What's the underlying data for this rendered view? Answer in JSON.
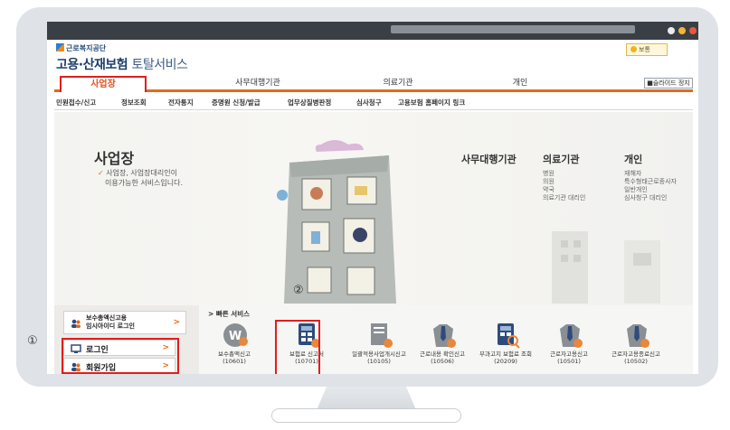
{
  "header": {
    "org_name": "근로복지공단",
    "service_title_main": "고용·산재보험",
    "service_title_rest": "토탈서비스",
    "weather_label": "보통"
  },
  "top_tabs": [
    {
      "label": "사업장"
    },
    {
      "label": "사무대행기관"
    },
    {
      "label": "의료기관"
    },
    {
      "label": "개인"
    }
  ],
  "slide_stop_label": "■슬라이드 정지",
  "submenu": [
    "민원접수/신고",
    "정보조회",
    "전자통지",
    "증명원 신청/발급",
    "업무상질병판정",
    "심사청구",
    "고용보험 홈페이지 링크"
  ],
  "hero": {
    "title": "사업장",
    "desc_line1": "사업장, 사업장대리인이",
    "desc_line2": "이용가능한 서비스입니다.",
    "check_mark": "✓"
  },
  "categories": {
    "agency": {
      "title": "사무대행기관"
    },
    "medical": {
      "title": "의료기관",
      "items": [
        "병원",
        "의원",
        "약국",
        "의료기관 대리인"
      ]
    },
    "personal": {
      "title": "개인",
      "items": [
        "재해자",
        "특수형태근로종사자",
        "일반개인",
        "심사청구 대리인"
      ]
    }
  },
  "left_panel": {
    "cert_line1": "보수총액신고용",
    "cert_line2": "임시아이디 로그인",
    "login_label": "로그인",
    "signup_label": "회원가입",
    "arrow": ">"
  },
  "annotations": {
    "marker1": "①",
    "marker2": "②"
  },
  "quick_services": {
    "title": "> 빠른 서비스",
    "items": [
      {
        "name": "보수총액신고",
        "code": "(10601)"
      },
      {
        "name": "보험료 신고서",
        "code": "(10701)"
      },
      {
        "name": "일괄적용사업개시신고(10105)",
        "code": ""
      },
      {
        "name": "근로내용 확인신고(10506)",
        "code": ""
      },
      {
        "name": "부과고지 보험료 조회(20209)",
        "code": ""
      },
      {
        "name": "근로자고용신고",
        "code": "(10501)"
      },
      {
        "name": "근로자고용종료신고(10502)",
        "code": ""
      }
    ]
  },
  "colors": {
    "accent": "#e46a1c",
    "highlight": "#e01e1e",
    "brand": "#1d3e6b"
  }
}
